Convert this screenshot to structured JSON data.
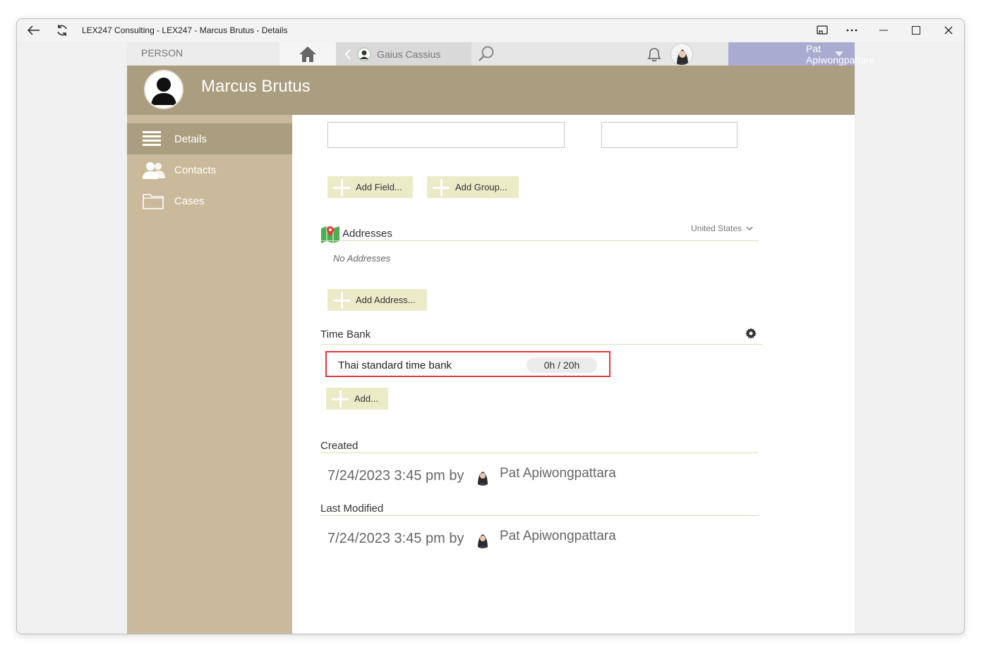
{
  "window": {
    "title": "LEX247 Consulting - LEX247 - Marcus Brutus - Details",
    "back_icon": "arrow-left-icon",
    "refresh_icon": "refresh-icon",
    "cast_icon": "cast-icon",
    "more_icon": "more-icon",
    "minimize_icon": "minimize-icon",
    "maximize_icon": "maximize-icon",
    "close_icon": "close-icon"
  },
  "nav": {
    "section_label": "PERSON",
    "previous_label": "Gaius Cassius",
    "user_name": "Pat Apiwongpattara"
  },
  "header": {
    "name": "Marcus Brutus"
  },
  "sidebar": {
    "items": [
      {
        "label": "Details",
        "icon": "list-icon",
        "active": true
      },
      {
        "label": "Contacts",
        "icon": "people-icon",
        "active": false
      },
      {
        "label": "Cases",
        "icon": "folder-icon",
        "active": false
      }
    ]
  },
  "content": {
    "add_field_label": "Add Field...",
    "add_group_label": "Add Group...",
    "addresses": {
      "title": "Addresses",
      "country": "United States",
      "empty_note": "No Addresses",
      "add_label": "Add Address..."
    },
    "time_bank": {
      "title": "Time Bank",
      "entry_label": "Thai standard time bank",
      "entry_value": "0h / 20h",
      "add_label": "Add..."
    },
    "created": {
      "title": "Created",
      "timestamp": "7/24/2023 3:45 pm by",
      "user": "Pat Apiwongpattara"
    },
    "modified": {
      "title": "Last Modified",
      "timestamp": "7/24/2023 3:45 pm by",
      "user": "Pat Apiwongpattara"
    }
  },
  "colors": {
    "header_bg": "#ab9d80",
    "sidebar_bg": "#cbb99b",
    "button_bg": "#ecebc8",
    "user_bg": "#a9acd0",
    "highlight_border": "#e0393e"
  }
}
